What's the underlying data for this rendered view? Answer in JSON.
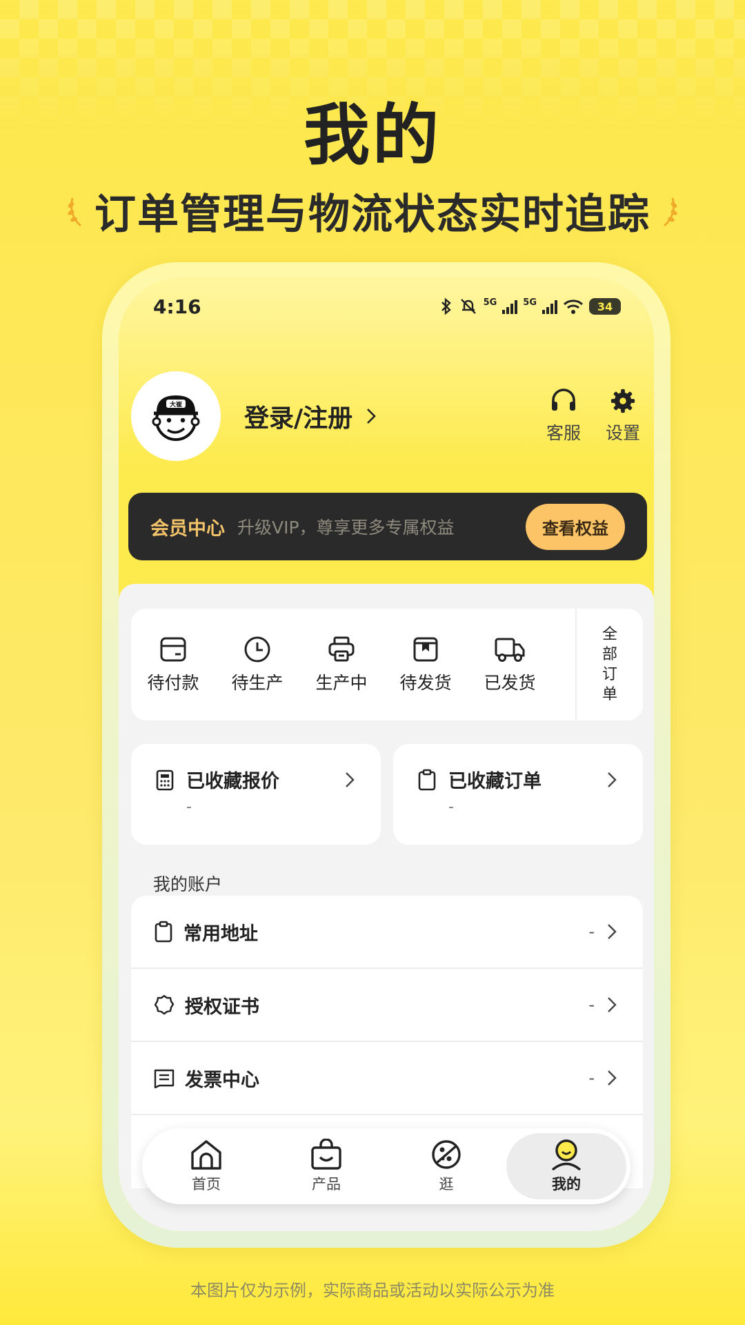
{
  "promo": {
    "title": "我的",
    "subtitle": "订单管理与物流状态实时追踪",
    "footnote": "本图片仅为示例，实际商品或活动以实际公示为准"
  },
  "status_bar": {
    "time": "4:16",
    "network_1": "5G",
    "network_2": "5G",
    "battery": "34"
  },
  "profile": {
    "avatar_badge": "大崔",
    "login_label": "登录/注册",
    "service_label": "客服",
    "settings_label": "设置"
  },
  "vip": {
    "title": "会员中心",
    "description": "升级VIP，尊享更多专属权益",
    "button": "查看权益"
  },
  "orders": {
    "items": [
      {
        "label": "待付款",
        "icon": "wallet-icon"
      },
      {
        "label": "待生产",
        "icon": "clock-icon"
      },
      {
        "label": "生产中",
        "icon": "printer-icon"
      },
      {
        "label": "待发货",
        "icon": "package-icon"
      },
      {
        "label": "已发货",
        "icon": "truck-icon"
      }
    ],
    "all_label": [
      "全",
      "部",
      "订",
      "单"
    ]
  },
  "favorites": {
    "quotes": {
      "label": "已收藏报价",
      "value": "-"
    },
    "orders": {
      "label": "已收藏订单",
      "value": "-"
    }
  },
  "account": {
    "title": "我的账户",
    "items": [
      {
        "label": "常用地址",
        "value": "-"
      },
      {
        "label": "授权证书",
        "value": "-"
      },
      {
        "label": "发票中心",
        "value": "-"
      }
    ]
  },
  "tabbar": {
    "items": [
      {
        "label": "首页",
        "active": false
      },
      {
        "label": "产品",
        "active": false
      },
      {
        "label": "逛",
        "active": false
      },
      {
        "label": "我的",
        "active": true
      }
    ]
  },
  "colors": {
    "brand_yellow": "#fde94a",
    "vip_gold": "#f4c46a",
    "vip_button": "#fcc467",
    "dark": "#2b2a2a"
  }
}
